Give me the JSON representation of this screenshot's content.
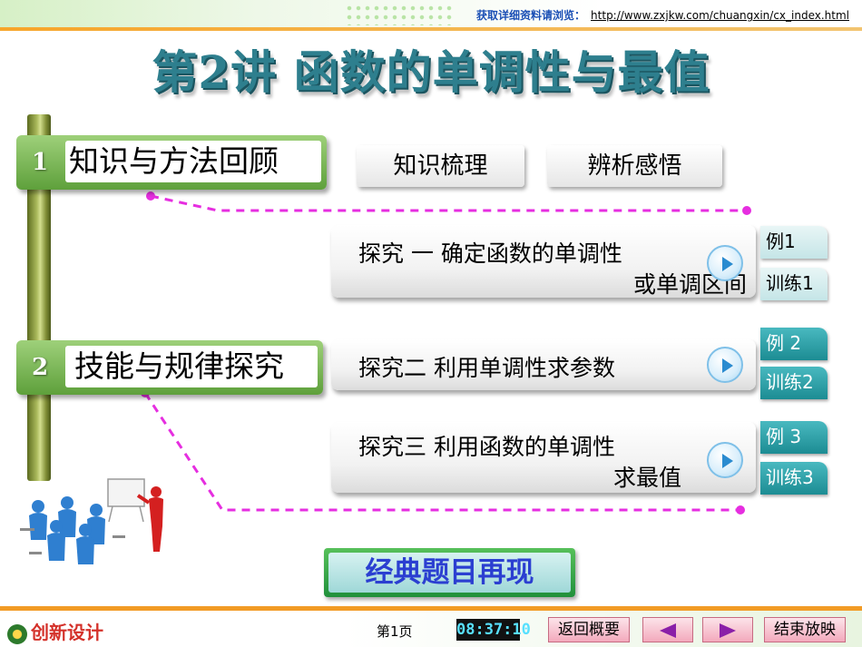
{
  "header": {
    "link_label": "获取详细资料请浏览：",
    "link_url": "http://www.zxjkw.com/chuangxin/cx_index.html"
  },
  "title": "第2讲  函数的单调性与最值",
  "sections": [
    {
      "number": "1",
      "label": "知识与方法回顾"
    },
    {
      "number": "2",
      "label": "技能与规律探究"
    }
  ],
  "knowledge_buttons": [
    "知识梳理",
    "辨析感悟"
  ],
  "explores": [
    {
      "line1": "探究 一    确定函数的单调性",
      "line2": "或单调区间"
    },
    {
      "line1": "探究二    利用单调性求参数",
      "line2": ""
    },
    {
      "line1": "探究三    利用函数的单调性",
      "line2": "求最值"
    }
  ],
  "examples": [
    {
      "label": "例1",
      "style": "light"
    },
    {
      "label": "训练1",
      "style": "light"
    },
    {
      "label": "例 2",
      "style": "teal"
    },
    {
      "label": "训练2",
      "style": "teal"
    },
    {
      "label": "例 3",
      "style": "teal"
    },
    {
      "label": "训练3",
      "style": "teal"
    }
  ],
  "classic_button": "经典题目再现",
  "footer": {
    "logo_text": "创新设计",
    "page": "第1页",
    "clock": "08:37:10",
    "back_label": "返回概要",
    "end_label": "结束放映"
  },
  "colors": {
    "title": "#2e7f8e",
    "section_green": "#5ea03b",
    "dashed_line": "#e62ee0",
    "example_teal": "#1c8c93",
    "classic_text": "#2b3fd1"
  }
}
